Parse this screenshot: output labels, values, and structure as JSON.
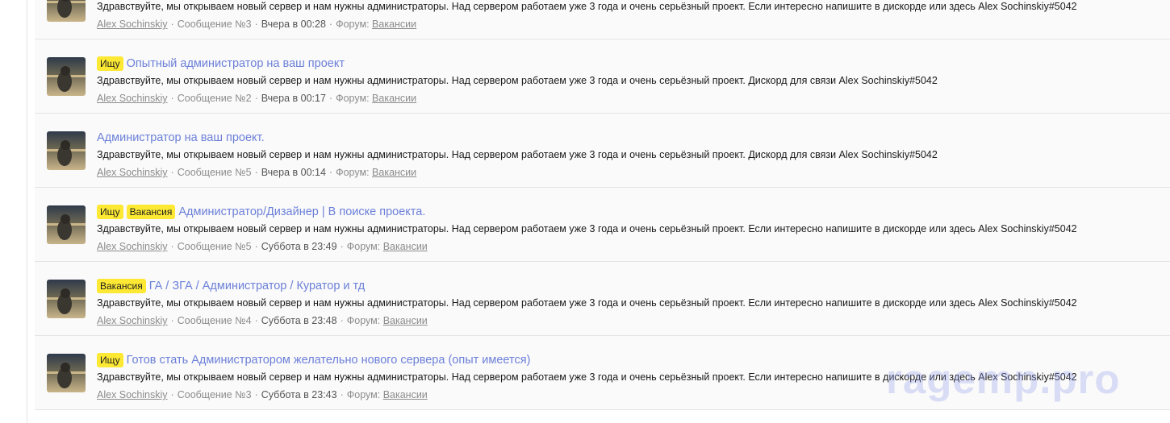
{
  "results": [
    {
      "labels": [],
      "title": "",
      "snippet": "Здравствуйте, мы открываем новый сервер и нам нужны администраторы. Над сервером работаем уже 3 года и очень серьёзный проект. Если интересно напишите в дискорде или здесь Alex Sochinskiy#5042",
      "author": "Alex Sochinskiy",
      "post": "Сообщение №3",
      "date": "Вчера в 00:28",
      "forum_label": "Форум:",
      "forum": "Вакансии"
    },
    {
      "labels": [
        "Ищу"
      ],
      "title": "Опытный администратор на ваш проект",
      "snippet": "Здравствуйте, мы открываем новый сервер и нам нужны администраторы. Над сервером работаем уже 3 года и очень серьёзный проект. Дискорд для связи Alex Sochinskiy#5042",
      "author": "Alex Sochinskiy",
      "post": "Сообщение №2",
      "date": "Вчера в 00:17",
      "forum_label": "Форум:",
      "forum": "Вакансии"
    },
    {
      "labels": [],
      "title": "Администратор на ваш проект.",
      "snippet": "Здравствуйте, мы открываем новый сервер и нам нужны администраторы. Над сервером работаем уже 3 года и очень серьёзный проект. Дискорд для связи Alex Sochinskiy#5042",
      "author": "Alex Sochinskiy",
      "post": "Сообщение №5",
      "date": "Вчера в 00:14",
      "forum_label": "Форум:",
      "forum": "Вакансии"
    },
    {
      "labels": [
        "Ищу",
        "Вакансия"
      ],
      "title": "Администратор/Дизайнер | В поиске проекта.",
      "snippet": "Здравствуйте, мы открываем новый сервер и нам нужны администраторы. Над сервером работаем уже 3 года и очень серьёзный проект. Если интересно напишите в дискорде или здесь Alex Sochinskiy#5042",
      "author": "Alex Sochinskiy",
      "post": "Сообщение №5",
      "date": "Суббота в 23:49",
      "forum_label": "Форум:",
      "forum": "Вакансии"
    },
    {
      "labels": [
        "Вакансия"
      ],
      "title": "ГА / ЗГА / Администратор / Куратор и тд",
      "snippet": "Здравствуйте, мы открываем новый сервер и нам нужны администраторы. Над сервером работаем уже 3 года и очень серьёзный проект. Если интересно напишите в дискорде или здесь Alex Sochinskiy#5042",
      "author": "Alex Sochinskiy",
      "post": "Сообщение №4",
      "date": "Суббота в 23:48",
      "forum_label": "Форум:",
      "forum": "Вакансии"
    },
    {
      "labels": [
        "Ищу"
      ],
      "title": "Готов стать Администратором желательно нового сервера (опыт имеется)",
      "snippet": "Здравствуйте, мы открываем новый сервер и нам нужны администраторы. Над сервером работаем уже 3 года и очень серьёзный проект. Если интересно напишите в дискорде или здесь Alex Sochinskiy#5042",
      "author": "Alex Sochinskiy",
      "post": "Сообщение №3",
      "date": "Суббота в 23:43",
      "forum_label": "Форум:",
      "forum": "Вакансии"
    }
  ],
  "watermark": "ragemp.pro",
  "colors": {
    "label_bg": "#fde933",
    "title_link": "#6c80d9",
    "meta_text": "#8c8c8c",
    "row_bg": "#fafafa"
  }
}
